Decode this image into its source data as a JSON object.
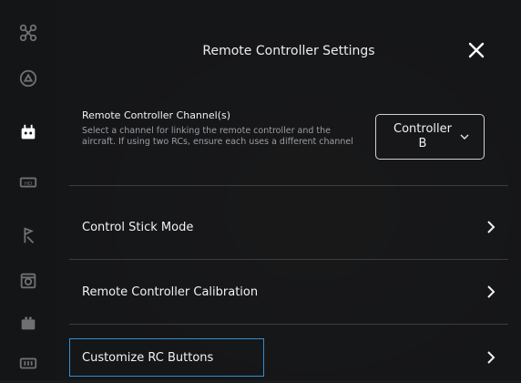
{
  "sidebar": {
    "items": [
      {
        "icon": "drone-icon"
      },
      {
        "icon": "camera-icon"
      },
      {
        "icon": "remote-controller-icon",
        "active": true
      },
      {
        "icon": "transmission-icon"
      },
      {
        "icon": "safety-icon"
      },
      {
        "icon": "gimbal-icon"
      },
      {
        "icon": "battery-icon"
      },
      {
        "icon": "more-icon"
      }
    ]
  },
  "header": {
    "title": "Remote Controller Settings"
  },
  "channel": {
    "heading": "Remote Controller Channel(s)",
    "description": "Select a channel for linking the remote controller and the aircraft. If using two RCs, ensure each uses a different channel",
    "selected_value": "Controller B"
  },
  "rows": [
    {
      "label": "Control Stick Mode"
    },
    {
      "label": "Remote Controller Calibration"
    },
    {
      "label": "Customize RC Buttons"
    }
  ],
  "colors": {
    "highlight": "#2f8fd4",
    "background": "#141517"
  }
}
